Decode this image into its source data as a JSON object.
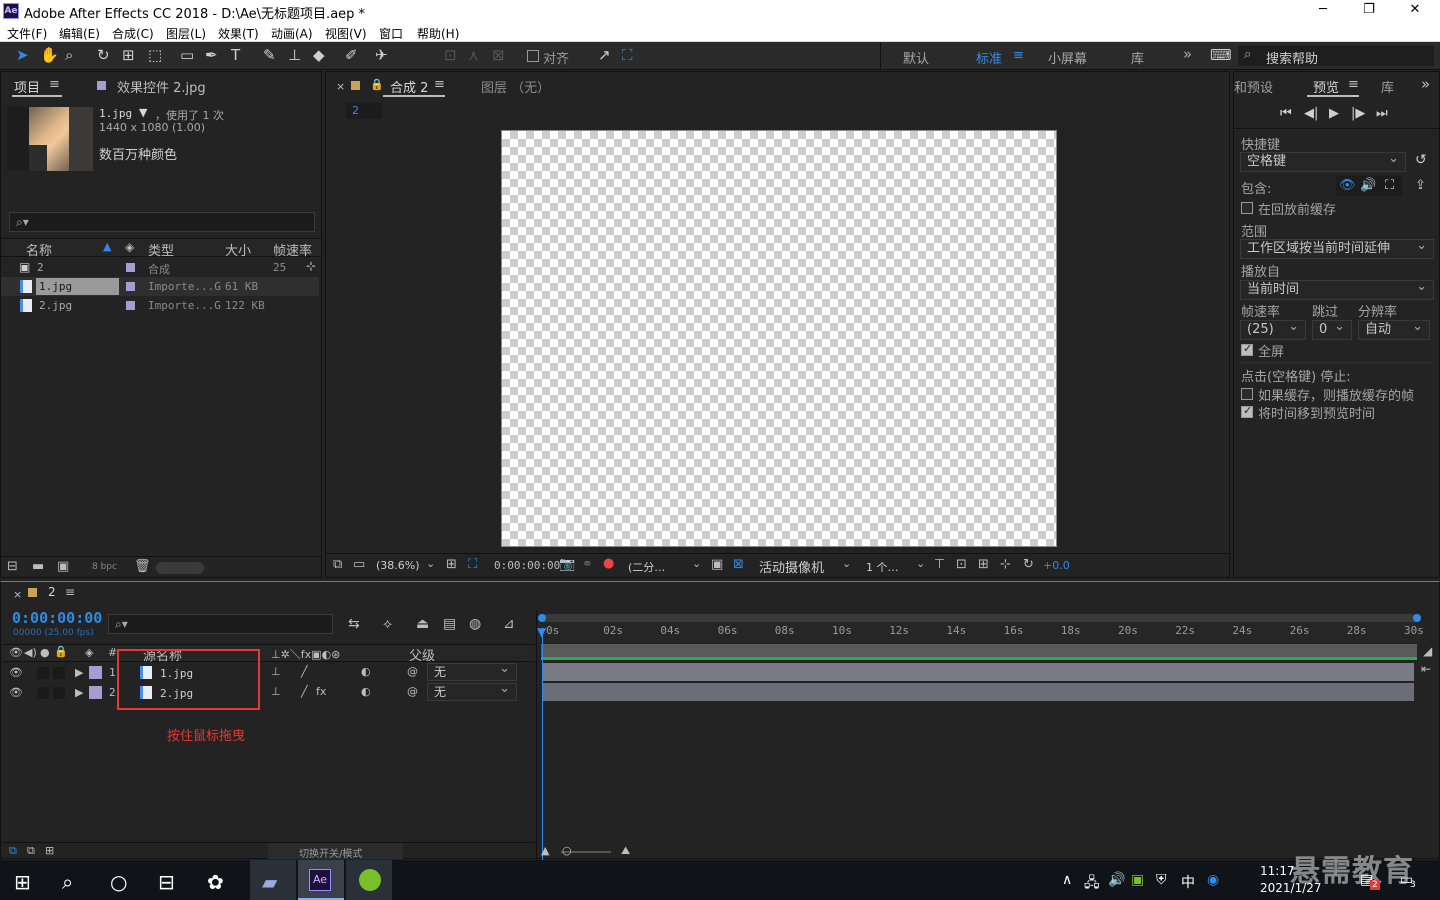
{
  "window": {
    "logo": "Ae",
    "title": "Adobe After Effects CC 2018 - D:\\Ae\\无标题项目.aep *",
    "minimize": "─",
    "maximize": "❐",
    "close": "✕"
  },
  "menu": [
    "文件(F)",
    "编辑(E)",
    "合成(C)",
    "图层(L)",
    "效果(T)",
    "动画(A)",
    "视图(V)",
    "窗口",
    "帮助(H)"
  ],
  "toolbar": {
    "snap_label": "对齐",
    "workspaces": [
      "默认",
      "标准",
      "小屏幕",
      "库"
    ],
    "active_workspace_color": "#2d8ceb",
    "more": "»",
    "search_placeholder": "搜索帮助"
  },
  "project_panel": {
    "tab_project": "项目",
    "tab_effects": "效果控件 2.jpg",
    "selected_name": "1.jpg",
    "usage": "，使用了 1 次",
    "dimensions": "1440 x 1080 (1.00)",
    "color_info": "数百万种颜色",
    "search_icon": "⌕▾",
    "columns": [
      "名称",
      "类型",
      "大小",
      "帧速率"
    ],
    "items": [
      {
        "name": "2",
        "type": "合成",
        "size": "",
        "fps": "25"
      },
      {
        "name": "1.jpg",
        "type": "Importe...G",
        "size": "61 KB",
        "fps": ""
      },
      {
        "name": "2.jpg",
        "type": "Importe...G",
        "size": "122 KB",
        "fps": ""
      }
    ],
    "bpc": "8 bpc"
  },
  "comp_panel": {
    "tab_comp": "合成 2",
    "tab_layer": "图层 （无）",
    "comp_name_chip": "2",
    "zoom": "(38.6%)",
    "timecode": "0:00:00:00",
    "resolution": "(二分…",
    "camera": "活动摄像机",
    "views": "1 个…",
    "exposure": "+0.0"
  },
  "preview_panel": {
    "tab_presets": "和预设",
    "tab_preview": "预览",
    "tab_library": "库",
    "shortcut_label": "快捷键",
    "shortcut_value": "空格键",
    "include_label": "包含:",
    "cache_before": "在回放前缓存",
    "range_label": "范围",
    "range_value": "工作区域按当前时间延伸",
    "play_from_label": "播放自",
    "play_from_value": "当前时间",
    "fps_label": "帧速率",
    "skip_label": "跳过",
    "res_label": "分辨率",
    "fps_value": "(25)",
    "skip_value": "0",
    "res_value": "自动",
    "fullscreen": "全屏",
    "stop_label": "点击(空格键) 停止:",
    "if_cached": "如果缓存，则播放缓存的帧",
    "move_time": "将时间移到预览时间"
  },
  "timeline": {
    "tab": "2",
    "timecode": "0:00:00:00",
    "frame_info": "00000 (25.00 fps)",
    "col_name": "源名称",
    "col_parent": "父级",
    "ticks": [
      "0s",
      "02s",
      "04s",
      "06s",
      "08s",
      "10s",
      "12s",
      "14s",
      "16s",
      "18s",
      "20s",
      "22s",
      "24s",
      "26s",
      "28s",
      "30s"
    ],
    "layers": [
      {
        "num": "1",
        "name": "1.jpg",
        "parent": "无"
      },
      {
        "num": "2",
        "name": "2.jpg",
        "parent": "无"
      }
    ],
    "annotation": "按住鼠标拖曳",
    "annotation_color": "#e53935",
    "toggle_label": "切换开关/模式"
  },
  "taskbar": {
    "time": "11:17",
    "date": "2021/1/27",
    "ime": "中",
    "ae_label": "Ae",
    "notif_count": "3",
    "badge": "2",
    "watermark": "悬需教育"
  }
}
